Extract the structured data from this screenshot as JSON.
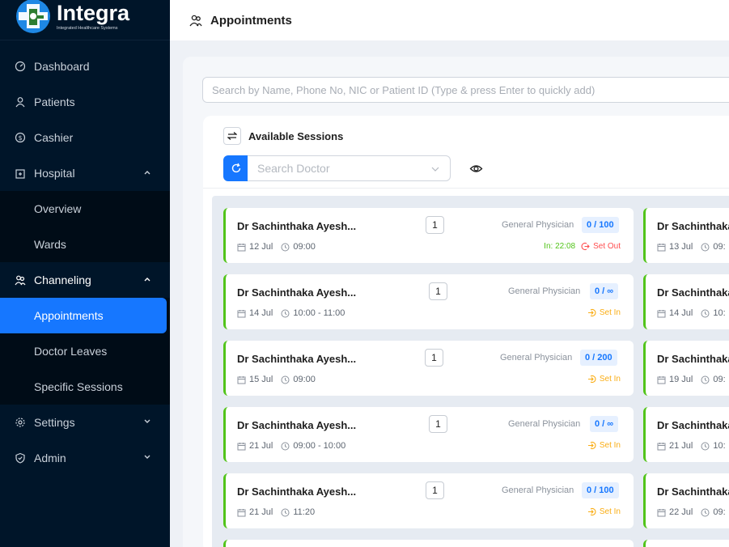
{
  "brand": {
    "title": "Integra",
    "subtitle": "Integrated Healthcare Systems"
  },
  "header": {
    "title": "Appointments"
  },
  "sidebar": {
    "items": [
      {
        "label": "Dashboard"
      },
      {
        "label": "Patients"
      },
      {
        "label": "Cashier"
      },
      {
        "label": "Hospital"
      },
      {
        "label": "Channeling"
      },
      {
        "label": "Settings"
      },
      {
        "label": "Admin"
      }
    ],
    "hospital_sub": [
      {
        "label": "Overview"
      },
      {
        "label": "Wards"
      }
    ],
    "channeling_sub": [
      {
        "label": "Appointments"
      },
      {
        "label": "Doctor Leaves"
      },
      {
        "label": "Specific Sessions"
      }
    ]
  },
  "search": {
    "placeholder": "Search by Name, Phone No, NIC or Patient ID (Type & press Enter to quickly add)"
  },
  "sessions": {
    "title": "Available Sessions",
    "doctor_placeholder": "Search Doctor",
    "cards": [
      {
        "name": "Dr Sachinthaka Ayesh...",
        "num": "1",
        "spec": "General Physician",
        "count": "0 / 100",
        "date": "12 Jul",
        "time": "09:00",
        "in_time": "In: 22:08",
        "action": "Set Out"
      },
      {
        "name": "Dr Sachinthaka Ayesh...",
        "num": "1",
        "spec": "General Physician",
        "count": "0 / ∞",
        "date": "14 Jul",
        "time": "10:00 - 11:00",
        "action": "Set In"
      },
      {
        "name": "Dr Sachinthaka Ayesh...",
        "num": "1",
        "spec": "General Physician",
        "count": "0 / 200",
        "date": "15 Jul",
        "time": "09:00",
        "action": "Set In"
      },
      {
        "name": "Dr Sachinthaka Ayesh...",
        "num": "1",
        "spec": "General Physician",
        "count": "0 / ∞",
        "date": "21 Jul",
        "time": "09:00 - 10:00",
        "action": "Set In"
      },
      {
        "name": "Dr Sachinthaka Ayesh...",
        "num": "1",
        "spec": "General Physician",
        "count": "0 / 100",
        "date": "21 Jul",
        "time": "11:20",
        "action": "Set In"
      }
    ],
    "cards_right": [
      {
        "name": "Dr Sachinthaka",
        "date": "13 Jul",
        "time": "09:"
      },
      {
        "name": "Dr Sachinthaka",
        "date": "14 Jul",
        "time": "10:"
      },
      {
        "name": "Dr Sachinthaka",
        "date": "19 Jul",
        "time": "09:"
      },
      {
        "name": "Dr Sachinthaka",
        "date": "21 Jul",
        "time": "10:"
      },
      {
        "name": "Dr Sachinthaka",
        "date": "22 Jul",
        "time": "09:"
      }
    ]
  },
  "colors": {
    "sidebar_bg": "#001529",
    "accent": "#1677ff",
    "success": "#52c41a",
    "danger": "#ff4d4f",
    "warning": "#faad14"
  }
}
